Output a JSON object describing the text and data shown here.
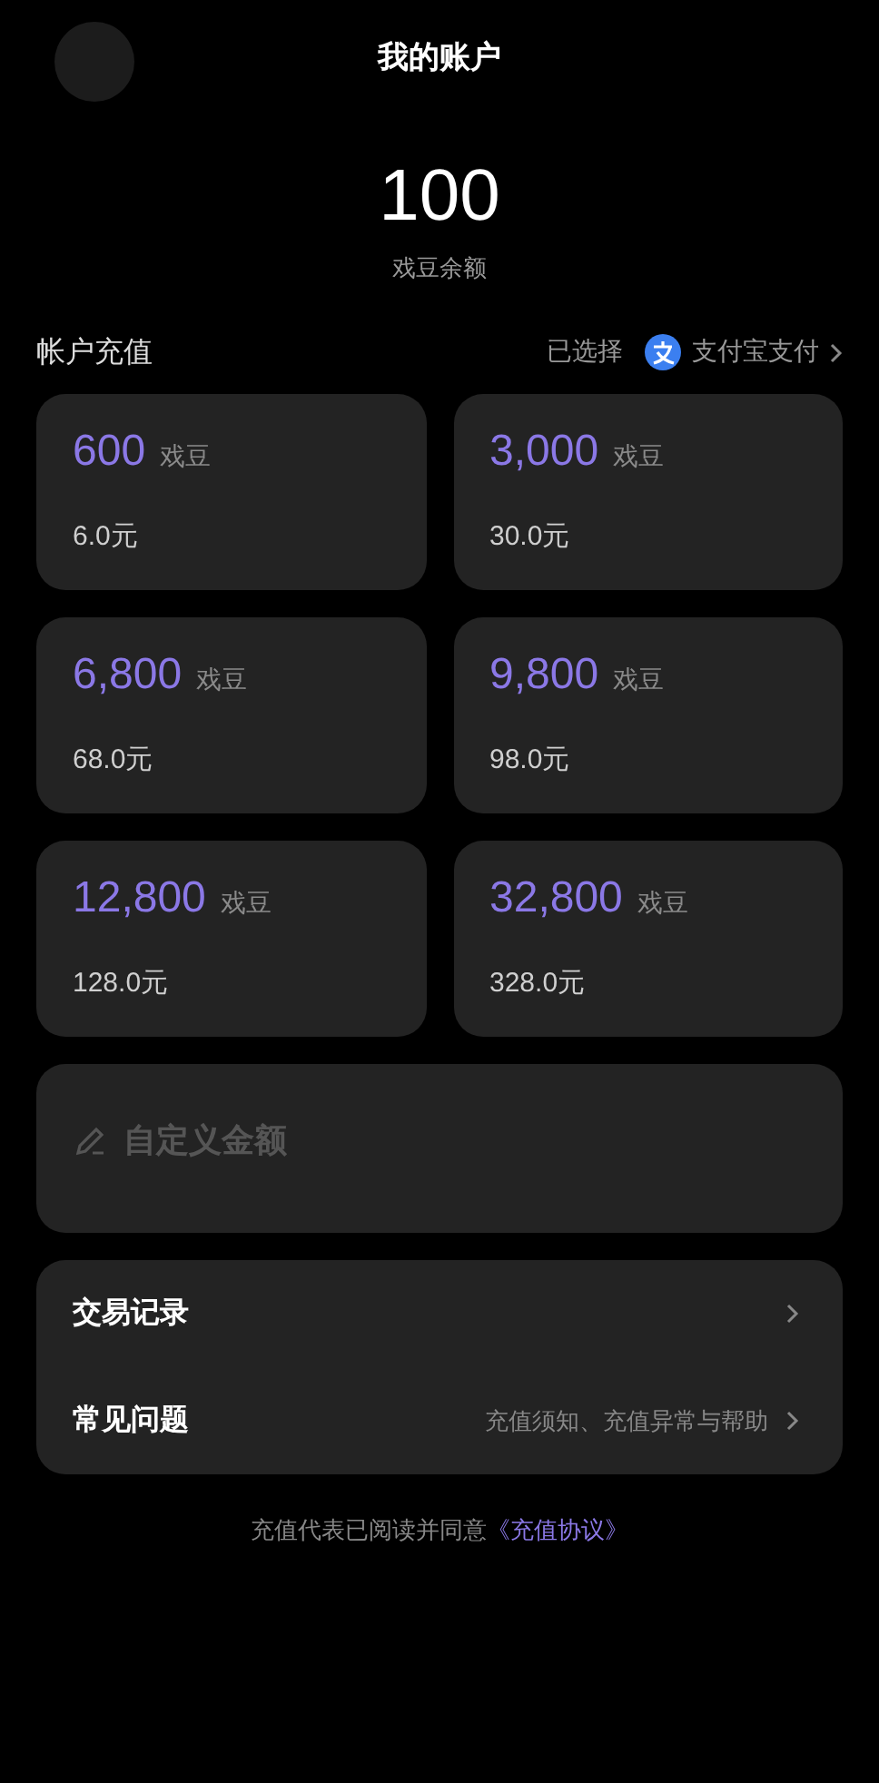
{
  "header": {
    "title": "我的账户"
  },
  "balance": {
    "amount": "100",
    "label": "戏豆余额"
  },
  "recharge": {
    "title": "帐户充值",
    "selected_prefix": "已选择",
    "payment_method": "支付宝支付"
  },
  "packages": [
    {
      "beans": "600",
      "unit": "戏豆",
      "price": "6.0元"
    },
    {
      "beans": "3,000",
      "unit": "戏豆",
      "price": "30.0元"
    },
    {
      "beans": "6,800",
      "unit": "戏豆",
      "price": "68.0元"
    },
    {
      "beans": "9,800",
      "unit": "戏豆",
      "price": "98.0元"
    },
    {
      "beans": "12,800",
      "unit": "戏豆",
      "price": "128.0元"
    },
    {
      "beans": "32,800",
      "unit": "戏豆",
      "price": "328.0元"
    }
  ],
  "custom_amount": {
    "placeholder": "自定义金额"
  },
  "menu": [
    {
      "label": "交易记录"
    },
    {
      "label": "常见问题",
      "hint": "充值须知、充值异常与帮助"
    }
  ],
  "footer": {
    "text": "充值代表已阅读并同意",
    "link": "《充值协议》"
  }
}
